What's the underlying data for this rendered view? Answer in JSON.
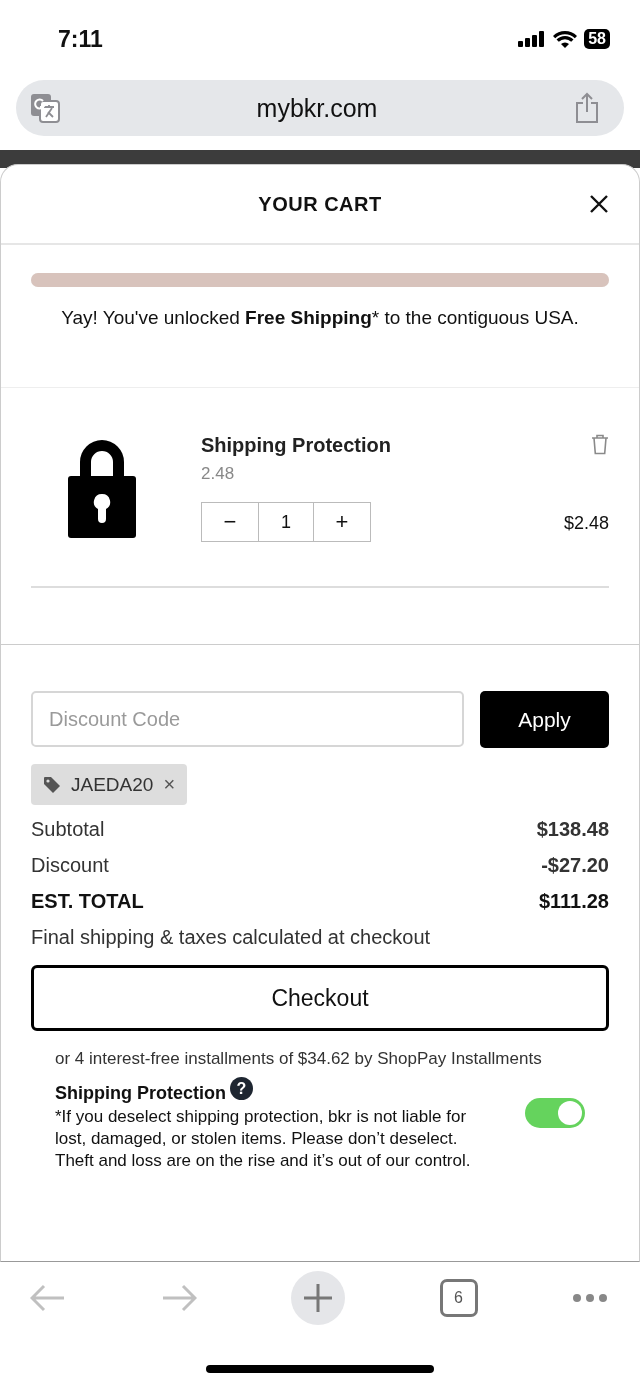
{
  "status_bar": {
    "time": "7:11",
    "battery": "58"
  },
  "browser": {
    "url": "mybkr.com",
    "tab_count": "6"
  },
  "cart": {
    "title": "YOUR CART",
    "shipping_progress": {
      "level": 1.0,
      "message": "Yay! You've unlocked **Free Shipping*** to the contiguous USA."
    },
    "items": [
      {
        "name": "Shipping Protection",
        "variant": "2.48",
        "quantity": "1",
        "minus": "−",
        "plus": "+",
        "price": "$2.48"
      }
    ],
    "discount": {
      "placeholder": "Discount Code",
      "apply": "Apply",
      "applied_code": "JAEDA20",
      "remove": "×"
    },
    "summary": [
      {
        "label": "Subtotal",
        "value": "$138.48",
        "kind": "normal"
      },
      {
        "label": "Discount",
        "value": "-$27.20",
        "kind": "normal"
      },
      {
        "label": "EST. TOTAL",
        "value": "$111.28",
        "kind": "total"
      }
    ],
    "note": "Final shipping & taxes calculated at checkout",
    "checkout": "Checkout",
    "installments": "or 4 interest-free installments of $34.62 by ShopPay Installments",
    "protection": {
      "title": "Shipping Protection",
      "help": "?",
      "text": "*If you deselect shipping protection, bkr is not liable for lost, damaged, or stolen items. Please don’t deselect. Theft and loss are on the rise and it’s out of our control.",
      "on": true
    }
  }
}
